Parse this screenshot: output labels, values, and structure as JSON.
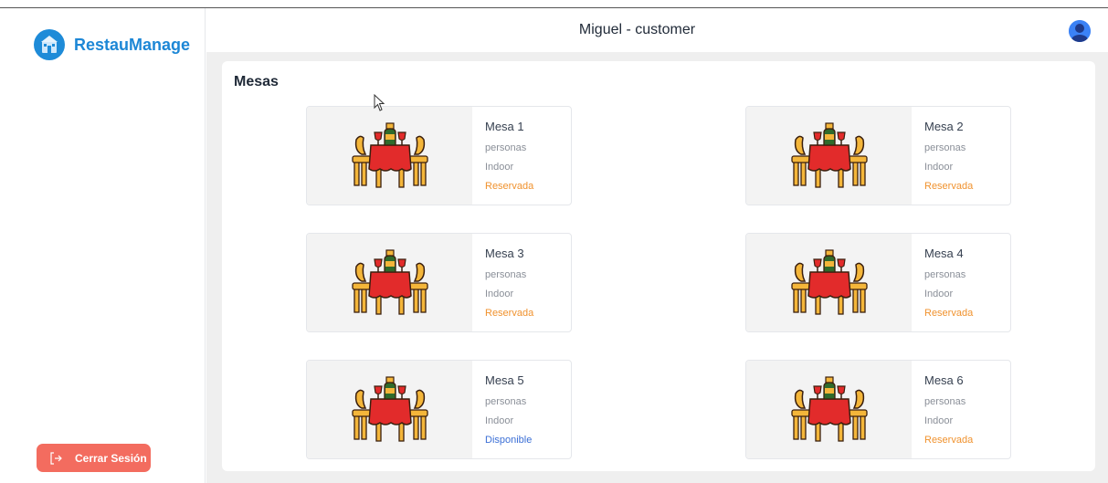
{
  "app": {
    "brand": "RestauManage"
  },
  "header": {
    "title": "Miguel - customer"
  },
  "sidebar": {
    "logout_label": "Cerrar Sesión"
  },
  "main": {
    "title": "Mesas",
    "tables": [
      {
        "name": "Mesa 1",
        "capacity": "personas",
        "location": "Indoor",
        "status": "Reservada",
        "status_kind": "reserved"
      },
      {
        "name": "Mesa 2",
        "capacity": "personas",
        "location": "Indoor",
        "status": "Reservada",
        "status_kind": "reserved"
      },
      {
        "name": "Mesa 3",
        "capacity": "personas",
        "location": "Indoor",
        "status": "Reservada",
        "status_kind": "reserved"
      },
      {
        "name": "Mesa 4",
        "capacity": "personas",
        "location": "Indoor",
        "status": "Reservada",
        "status_kind": "reserved"
      },
      {
        "name": "Mesa 5",
        "capacity": "personas",
        "location": "Indoor",
        "status": "Disponible",
        "status_kind": "available"
      },
      {
        "name": "Mesa 6",
        "capacity": "personas",
        "location": "Indoor",
        "status": "Reservada",
        "status_kind": "reserved"
      }
    ]
  },
  "colors": {
    "brand": "#1d87d6",
    "logout": "#f36c5f",
    "reserved": "#f0922e",
    "available": "#3b6fd6"
  }
}
